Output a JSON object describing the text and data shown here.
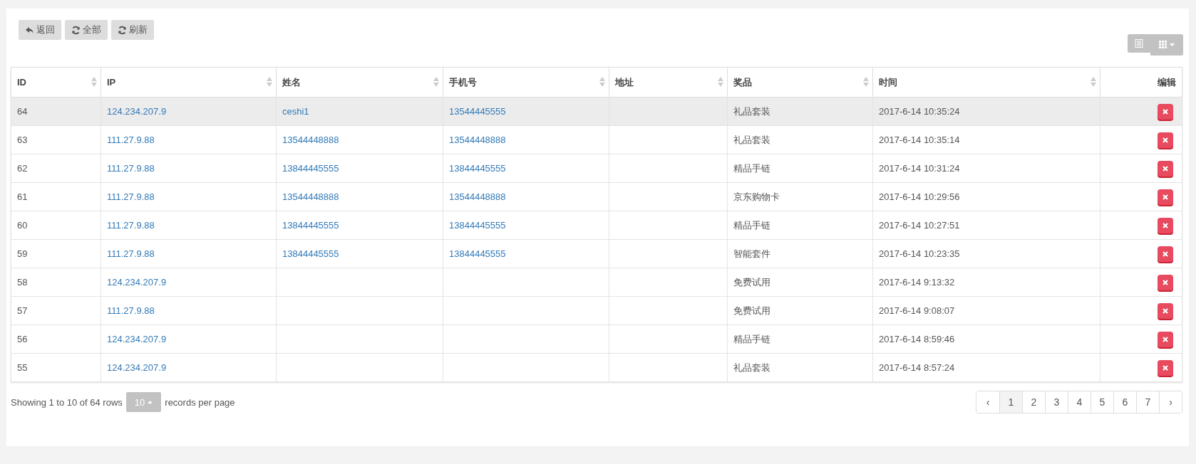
{
  "toolbar": {
    "buttons": [
      {
        "label": "返回",
        "kind": "back"
      },
      {
        "label": "全部",
        "kind": "refresh"
      },
      {
        "label": "刷新",
        "kind": "refresh"
      }
    ]
  },
  "table": {
    "columns": [
      {
        "label": "ID",
        "sortable": true
      },
      {
        "label": "IP",
        "sortable": true
      },
      {
        "label": "姓名",
        "sortable": true
      },
      {
        "label": "手机号",
        "sortable": true
      },
      {
        "label": "地址",
        "sortable": true
      },
      {
        "label": "奖品",
        "sortable": true
      },
      {
        "label": "时间",
        "sortable": true
      },
      {
        "label": "编辑",
        "sortable": false
      }
    ],
    "rows": [
      {
        "selected": true,
        "id": "64",
        "ip": "124.234.207.9",
        "name": "ceshi1",
        "phone": "13544445555",
        "prize": "礼品套装",
        "time": "2017-6-14 10:35:24"
      },
      {
        "selected": false,
        "id": "63",
        "ip": "111.27.9.88",
        "name": "13544448888",
        "phone": "13544448888",
        "prize": "礼品套装",
        "time": "2017-6-14 10:35:14"
      },
      {
        "selected": false,
        "id": "62",
        "ip": "111.27.9.88",
        "name": "13844445555",
        "phone": "13844445555",
        "prize": "精品手链",
        "time": "2017-6-14 10:31:24"
      },
      {
        "selected": false,
        "id": "61",
        "ip": "111.27.9.88",
        "name": "13544448888",
        "phone": "13544448888",
        "prize": "京东购物卡",
        "time": "2017-6-14 10:29:56"
      },
      {
        "selected": false,
        "id": "60",
        "ip": "111.27.9.88",
        "name": "13844445555",
        "phone": "13844445555",
        "prize": "精品手链",
        "time": "2017-6-14 10:27:51"
      },
      {
        "selected": false,
        "id": "59",
        "ip": "111.27.9.88",
        "name": "13844445555",
        "phone": "13844445555",
        "prize": "智能套件",
        "time": "2017-6-14 10:23:35"
      },
      {
        "selected": false,
        "id": "58",
        "ip": "124.234.207.9",
        "prize": "免费试用",
        "time": "2017-6-14 9:13:32"
      },
      {
        "selected": false,
        "id": "57",
        "ip": "111.27.9.88",
        "prize": "免费试用",
        "time": "2017-6-14 9:08:07"
      },
      {
        "selected": false,
        "id": "56",
        "ip": "124.234.207.9",
        "prize": "精品手链",
        "time": "2017-6-14 8:59:46"
      },
      {
        "selected": false,
        "id": "55",
        "ip": "124.234.207.9",
        "prize": "礼品套装",
        "time": "2017-6-14 8:57:24"
      }
    ]
  },
  "footer": {
    "showing": "Showing 1 to 10 of 64 rows",
    "page_size": "10",
    "per_page": "records per page"
  },
  "pagination": [
    {
      "label": "‹",
      "selected": false
    },
    {
      "label": "1",
      "selected": true
    },
    {
      "label": "2",
      "selected": false
    },
    {
      "label": "3",
      "selected": false
    },
    {
      "label": "4",
      "selected": false
    },
    {
      "label": "5",
      "selected": false
    },
    {
      "label": "6",
      "selected": false
    },
    {
      "label": "7",
      "selected": false
    },
    {
      "label": "›",
      "selected": false
    }
  ]
}
